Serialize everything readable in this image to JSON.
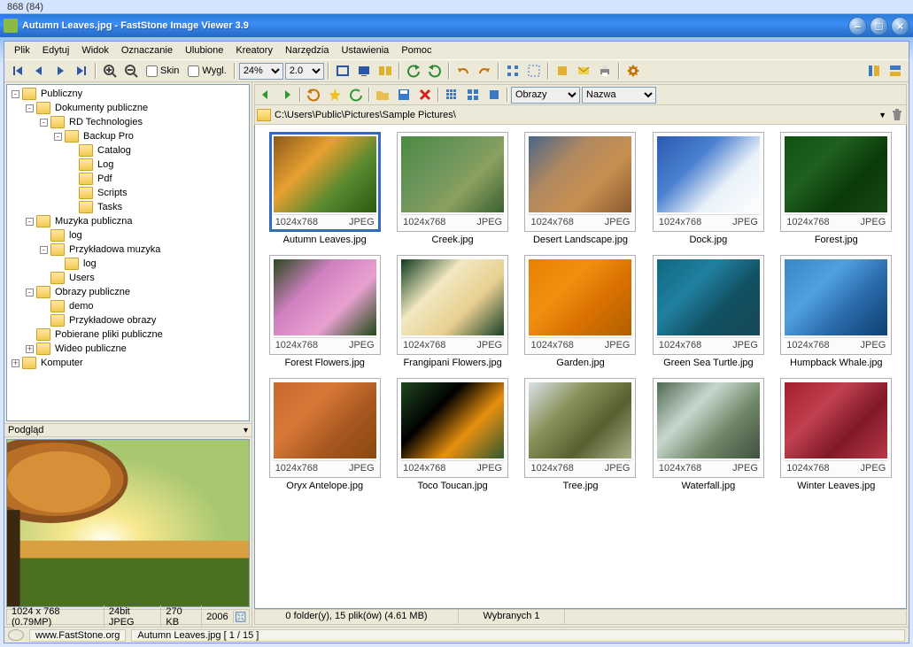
{
  "outer_top": "868 (84)",
  "title": "Autumn Leaves.jpg  -  FastStone Image Viewer 3.9",
  "menu": [
    "Plik",
    "Edytuj",
    "Widok",
    "Oznaczanie",
    "Ulubione",
    "Kreatory",
    "Narzędzia",
    "Ustawienia",
    "Pomoc"
  ],
  "toolbar1": {
    "skin_chk": "Skin",
    "view_chk": "Wygl.",
    "zoom_pct": "24%",
    "zoom_factor": "2.0"
  },
  "tree": [
    {
      "d": 0,
      "tog": "-",
      "label": "Publiczny"
    },
    {
      "d": 1,
      "tog": "-",
      "label": "Dokumenty publiczne"
    },
    {
      "d": 2,
      "tog": "-",
      "label": "RD Technologies"
    },
    {
      "d": 3,
      "tog": "-",
      "label": "Backup Pro"
    },
    {
      "d": 4,
      "tog": "",
      "label": "Catalog"
    },
    {
      "d": 4,
      "tog": "",
      "label": "Log"
    },
    {
      "d": 4,
      "tog": "",
      "label": "Pdf"
    },
    {
      "d": 4,
      "tog": "",
      "label": "Scripts"
    },
    {
      "d": 4,
      "tog": "",
      "label": "Tasks"
    },
    {
      "d": 1,
      "tog": "-",
      "label": "Muzyka publiczna"
    },
    {
      "d": 2,
      "tog": "",
      "label": "log"
    },
    {
      "d": 2,
      "tog": "-",
      "label": "Przykładowa muzyka"
    },
    {
      "d": 3,
      "tog": "",
      "label": "log"
    },
    {
      "d": 2,
      "tog": "",
      "label": "Users"
    },
    {
      "d": 1,
      "tog": "-",
      "label": "Obrazy publiczne"
    },
    {
      "d": 2,
      "tog": "",
      "label": "demo"
    },
    {
      "d": 2,
      "tog": "",
      "label": "Przykładowe obrazy"
    },
    {
      "d": 1,
      "tog": "",
      "label": "Pobierane pliki publiczne"
    },
    {
      "d": 1,
      "tog": "+",
      "label": "Wideo publiczne"
    },
    {
      "d": 0,
      "tog": "+",
      "label": "Komputer"
    }
  ],
  "preview_label": "Podgląd",
  "info": {
    "dim": "1024 x 768 (0.79MP)",
    "depth": "24bit JPEG",
    "size": "270 KB",
    "year": "2006"
  },
  "toolbar2": {
    "filter": "Obrazy",
    "sort": "Nazwa"
  },
  "path": "C:\\Users\\Public\\Pictures\\Sample Pictures\\",
  "thumbs": [
    {
      "name": "Autumn Leaves.jpg",
      "dim": "1024x768",
      "fmt": "JPEG",
      "g": [
        "#8b5a1a",
        "#e8a030",
        "#5a8a30",
        "#2a5a10"
      ],
      "sel": true
    },
    {
      "name": "Creek.jpg",
      "dim": "1024x768",
      "fmt": "JPEG",
      "g": [
        "#4a8a40",
        "#6a945a",
        "#8aa060",
        "#3a6030"
      ]
    },
    {
      "name": "Desert Landscape.jpg",
      "dim": "1024x768",
      "fmt": "JPEG",
      "g": [
        "#4a6688",
        "#b08860",
        "#c89050",
        "#8a5a30"
      ]
    },
    {
      "name": "Dock.jpg",
      "dim": "1024x768",
      "fmt": "JPEG",
      "g": [
        "#2a5ab0",
        "#4a80d0",
        "#e8f0f8",
        "#ffffff"
      ]
    },
    {
      "name": "Forest.jpg",
      "dim": "1024x768",
      "fmt": "JPEG",
      "g": [
        "#105010",
        "#206020",
        "#0a3a0a",
        "#184818"
      ]
    },
    {
      "name": "Forest Flowers.jpg",
      "dim": "1024x768",
      "fmt": "JPEG",
      "g": [
        "#2a4a20",
        "#d080c0",
        "#e8a0d0",
        "#204a18"
      ]
    },
    {
      "name": "Frangipani Flowers.jpg",
      "dim": "1024x768",
      "fmt": "JPEG",
      "g": [
        "#103a20",
        "#f0e8c0",
        "#e8d090",
        "#184028"
      ]
    },
    {
      "name": "Garden.jpg",
      "dim": "1024x768",
      "fmt": "JPEG",
      "g": [
        "#e88000",
        "#f09010",
        "#d87000",
        "#b06000"
      ]
    },
    {
      "name": "Green Sea Turtle.jpg",
      "dim": "1024x768",
      "fmt": "JPEG",
      "g": [
        "#106880",
        "#2080a0",
        "#105060",
        "#184858"
      ]
    },
    {
      "name": "Humpback Whale.jpg",
      "dim": "1024x768",
      "fmt": "JPEG",
      "g": [
        "#3888c8",
        "#50a0e0",
        "#2868a8",
        "#104070"
      ]
    },
    {
      "name": "Oryx Antelope.jpg",
      "dim": "1024x768",
      "fmt": "JPEG",
      "g": [
        "#c86830",
        "#d87838",
        "#a85820",
        "#884810"
      ]
    },
    {
      "name": "Toco Toucan.jpg",
      "dim": "1024x768",
      "fmt": "JPEG",
      "g": [
        "#204820",
        "#000000",
        "#e89010",
        "#305830"
      ]
    },
    {
      "name": "Tree.jpg",
      "dim": "1024x768",
      "fmt": "JPEG",
      "g": [
        "#d8e0e8",
        "#889058",
        "#586030",
        "#a8b088"
      ]
    },
    {
      "name": "Waterfall.jpg",
      "dim": "1024x768",
      "fmt": "JPEG",
      "g": [
        "#506850",
        "#c8d8d0",
        "#708868",
        "#405040"
      ]
    },
    {
      "name": "Winter Leaves.jpg",
      "dim": "1024x768",
      "fmt": "JPEG",
      "g": [
        "#a02030",
        "#c04050",
        "#801828",
        "#b83848"
      ]
    }
  ],
  "status": {
    "folders": "0 folder(y), 15 plik(ów) (4.61 MB)",
    "selected": "Wybranych 1"
  },
  "footer": {
    "url": "www.FastStone.org",
    "file": "Autumn Leaves.jpg [ 1 / 15 ]"
  }
}
